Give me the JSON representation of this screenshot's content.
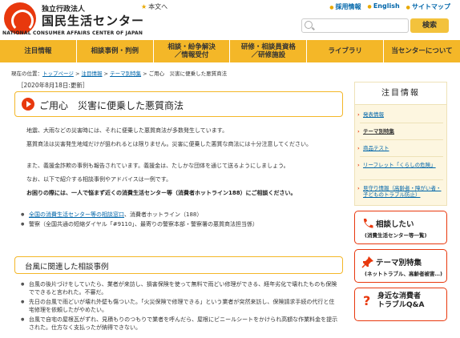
{
  "header": {
    "logo_sub": "独立行政法人",
    "logo_main": "国民生活センター",
    "logo_en": "NATIONAL CONSUMER AFFAIRS CENTER OF JAPAN",
    "new_label": "本文へ",
    "links": [
      "採用情報",
      "English",
      "サイトマップ"
    ],
    "search_placeholder": "",
    "search_button": "検索"
  },
  "nav": [
    "注目情報",
    "相談事例・判例",
    "相談・紛争解決\n／情報受付",
    "研修・相談員資格\n／研修施設",
    "ライブラリ",
    "当センターについて"
  ],
  "breadcrumb": {
    "prefix": "現在の位置：",
    "items": [
      "トップページ",
      "注目情報",
      "テーマ別特集",
      "ご用心　災害に便乗した悪質商法"
    ],
    "sep": " > "
  },
  "date": "［2020年8月18日:更新］",
  "title": "ご用心　災害に便乗した悪質商法",
  "paragraphs": [
    "地震、大雨などの災害時には、それに便乗した悪質商法が多数発生しています。",
    "悪質商法は災害発生地域だけが狙われるとは限りません。災害に便乗した悪質な商法には十分注意してください。",
    "また、義援金詐欺の事例も報告されています。義援金は、たしかな団体を通じて送るようにしましょう。",
    "なお、以下で紹介する相談事例やアドバイスは一例です。"
  ],
  "emphasis": "お困りの際には、一人で悩まず近くの消費生活センター等（消費者ホットライン188）にご相談ください。",
  "contacts": [
    {
      "link": "全国の消費生活センター等の相談窓口",
      "text": "、消費者ホットライン（188）"
    },
    {
      "link": "",
      "text": "警察（全国共通の短縮ダイヤル「#9110」、最寄りの警察本部・警察署の悪質商法担当係）"
    }
  ],
  "section_title": "台風に関連した相談事例",
  "cases": [
    "台風の後片づけをしていたら、業者が来訪し、損害保険を使って無料で雨どい修理ができる、経年劣化で壊れたものも保険でできると言われた。不審だ。",
    "先日の台風で雨どいが壊れ外壁も傷ついた。「火災保険で修理できる」という業者が突然来訪し、保険請求手続の代行と住宅修理を依頼したがやめたい。",
    "台風で自宅の屋根瓦がずれ、見積もりのつもりで業者を呼んだら、屋根にビニールシートをかけられ高額な作業料金を提示された。仕方なく支払ったが納得できない。"
  ],
  "sidebar": {
    "head": "注目情報",
    "items": [
      "発表情報",
      "テーマ別特集",
      "商品テスト",
      "リーフレット「くらしの危険」",
      "見守り情報（高齢者・障がい者・子どものトラブル防止）"
    ],
    "active_index": 1
  },
  "side_buttons": [
    {
      "label": "相談したい",
      "sub": "(消費生活センター等一覧)"
    },
    {
      "label": "テーマ別特集",
      "sub": "(ネットトラブル、高齢者被害…)"
    },
    {
      "label": "身近な消費者\nトラブルQ&A",
      "sub": ""
    }
  ],
  "colors": {
    "brand_red": "#e8380d",
    "nav_yellow": "#f4b728",
    "link_blue": "#0066aa"
  }
}
